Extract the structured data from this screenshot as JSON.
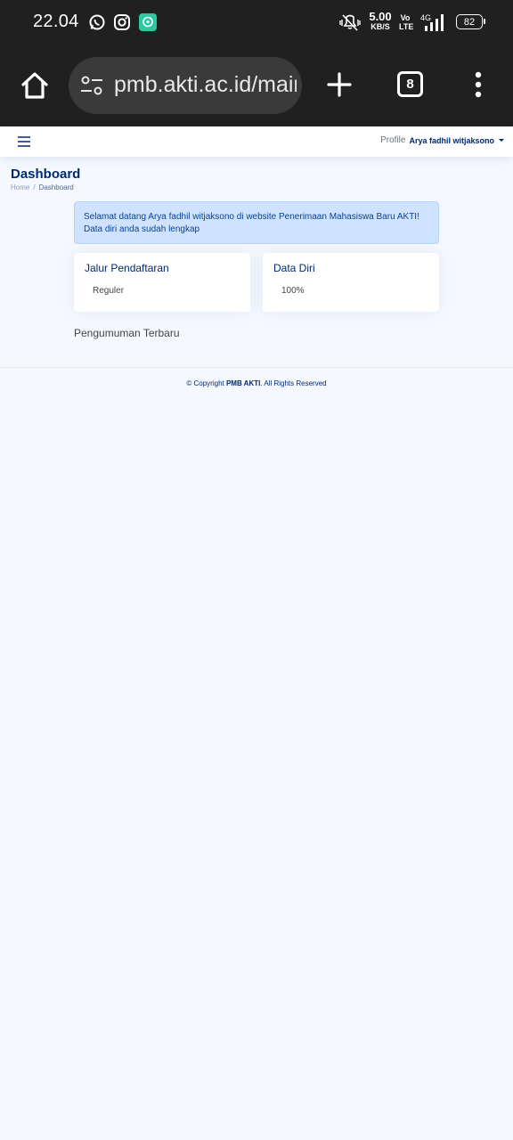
{
  "status_bar": {
    "time": "22.04",
    "net_speed": "5.00",
    "net_unit": "KB/S",
    "volte_top": "Vo",
    "volte_bottom": "LTE",
    "network": "4G",
    "battery": "82",
    "apps": [
      "whatsapp-icon",
      "instagram-icon",
      "chat-app-icon"
    ]
  },
  "browser": {
    "url": "pmb.akti.ac.id/main",
    "tab_count": "8"
  },
  "header": {
    "profile_alt": "Profile",
    "user_name": "Arya fadhil witjaksono"
  },
  "page": {
    "title": "Dashboard",
    "breadcrumb": [
      "Home",
      "Dashboard"
    ],
    "alert_line1": "Selamat datang Arya fadhil witjaksono di website Penerimaan Mahasiswa Baru AKTI!",
    "alert_line2": "Data diri anda sudah lengkap",
    "cards": [
      {
        "title": "Jalur Pendaftaran",
        "value": "Reguler"
      },
      {
        "title": "Data Diri",
        "value": "100%"
      }
    ],
    "announcements_title": "Pengumuman Terbaru"
  },
  "footer": {
    "prefix": "© Copyright ",
    "brand": "PMB AKTI",
    "suffix": ". All Rights Reserved"
  },
  "colors": {
    "brand": "#012970",
    "alert_bg": "#cfe2ff",
    "page_bg": "#f5f9ff"
  }
}
